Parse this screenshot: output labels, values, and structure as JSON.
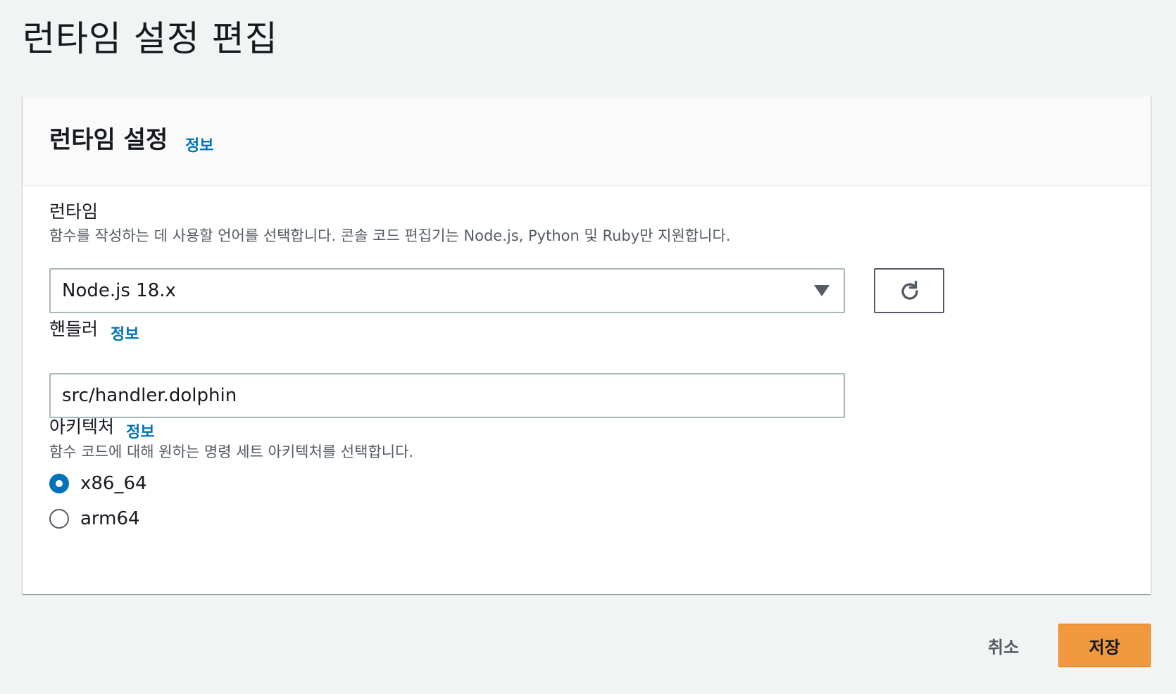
{
  "page": {
    "title": "런타임 설정 편집"
  },
  "panel": {
    "title": "런타임 설정",
    "info_label": "정보"
  },
  "runtime": {
    "label": "런타임",
    "description": "함수를 작성하는 데 사용할 언어를 선택합니다. 콘솔 코드 편집기는 Node.js, Python 및 Ruby만 지원합니다.",
    "selected_value": "Node.js 18.x",
    "refresh_icon": "refresh-icon",
    "dropdown_icon": "caret-down-icon"
  },
  "handler": {
    "label": "핸들러",
    "info_label": "정보",
    "value": "src/handler.dolphin"
  },
  "architecture": {
    "label": "아키텍처",
    "info_label": "정보",
    "description": "함수 코드에 대해 원하는 명령 세트 아키텍처를 선택합니다.",
    "options": [
      {
        "label": "x86_64",
        "selected": true
      },
      {
        "label": "arm64",
        "selected": false
      }
    ]
  },
  "footer": {
    "cancel_label": "취소",
    "save_label": "저장"
  },
  "colors": {
    "background": "#f2f3f3",
    "link": "#0073bb",
    "primary_button": "#f1993e",
    "text": "#16191f",
    "secondary_text": "#545b64"
  }
}
